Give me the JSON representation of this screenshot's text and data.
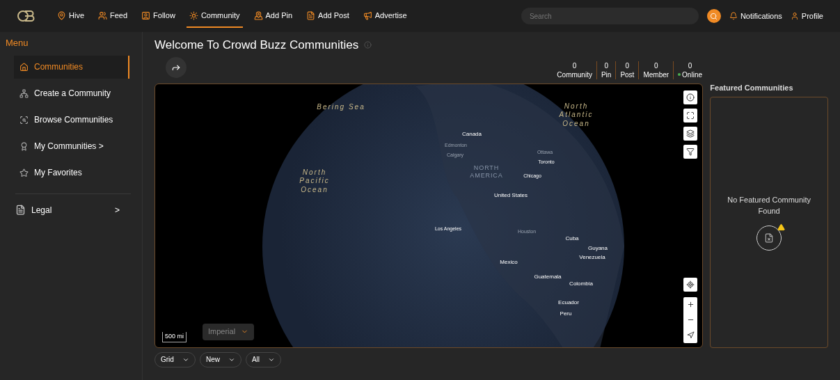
{
  "nav": {
    "items": [
      {
        "label": "Hive",
        "selected": false
      },
      {
        "label": "Feed",
        "selected": false
      },
      {
        "label": "Follow",
        "selected": false
      },
      {
        "label": "Community",
        "selected": true
      },
      {
        "label": "Add Pin",
        "selected": false
      },
      {
        "label": "Add Post",
        "selected": false
      },
      {
        "label": "Advertise",
        "selected": false
      }
    ],
    "search": {
      "placeholder": "Search"
    },
    "right": [
      {
        "label": "Notifications"
      },
      {
        "label": "Profile"
      }
    ]
  },
  "sidebar": {
    "title": "Menu",
    "items": [
      {
        "label": "Communities",
        "selected": true
      },
      {
        "label": "Create a Community",
        "selected": false
      },
      {
        "label": "Browse Communities",
        "selected": false
      },
      {
        "label": "My Communities >",
        "selected": false
      },
      {
        "label": "My Favorites",
        "selected": false
      }
    ],
    "legal": {
      "label": "Legal",
      "arrow": ">"
    }
  },
  "page": {
    "title": "Welcome To Crowd Buzz Communities"
  },
  "stats": [
    {
      "value": "0",
      "label": "Community",
      "online": false
    },
    {
      "value": "0",
      "label": "Pin",
      "online": false
    },
    {
      "value": "0",
      "label": "Post",
      "online": false
    },
    {
      "value": "0",
      "label": "Member",
      "online": false
    },
    {
      "value": "0",
      "label": "Online",
      "online": true
    }
  ],
  "map": {
    "labels": [
      {
        "text": "Bering Sea",
        "kind": "ocean"
      },
      {
        "text": "North Atlantic Ocean",
        "kind": "ocean"
      },
      {
        "text": "Canada",
        "kind": "country"
      },
      {
        "text": "Edmonton",
        "kind": "minor"
      },
      {
        "text": "Calgary",
        "kind": "minor"
      },
      {
        "text": "Ottawa",
        "kind": "minor"
      },
      {
        "text": "Toronto",
        "kind": "city"
      },
      {
        "text": "NORTH AMERICA",
        "kind": "region"
      },
      {
        "text": "Chicago",
        "kind": "city"
      },
      {
        "text": "North Pacific Ocean",
        "kind": "ocean"
      },
      {
        "text": "United States",
        "kind": "country"
      },
      {
        "text": "Los Angeles",
        "kind": "city"
      },
      {
        "text": "Houston",
        "kind": "minor"
      },
      {
        "text": "Cuba",
        "kind": "country"
      },
      {
        "text": "Guyana",
        "kind": "tiny"
      },
      {
        "text": "Venezuela",
        "kind": "tiny"
      },
      {
        "text": "Mexico",
        "kind": "country"
      },
      {
        "text": "Guatemala",
        "kind": "tiny"
      },
      {
        "text": "Colombia",
        "kind": "country"
      },
      {
        "text": "Ecuador",
        "kind": "country"
      },
      {
        "text": "Peru",
        "kind": "country"
      }
    ],
    "scale": "500 mi",
    "units": "Imperial"
  },
  "filters": [
    "Grid",
    "New",
    "All"
  ],
  "featured": {
    "title": "Featured Communities",
    "empty": "No Featured Community Found"
  }
}
